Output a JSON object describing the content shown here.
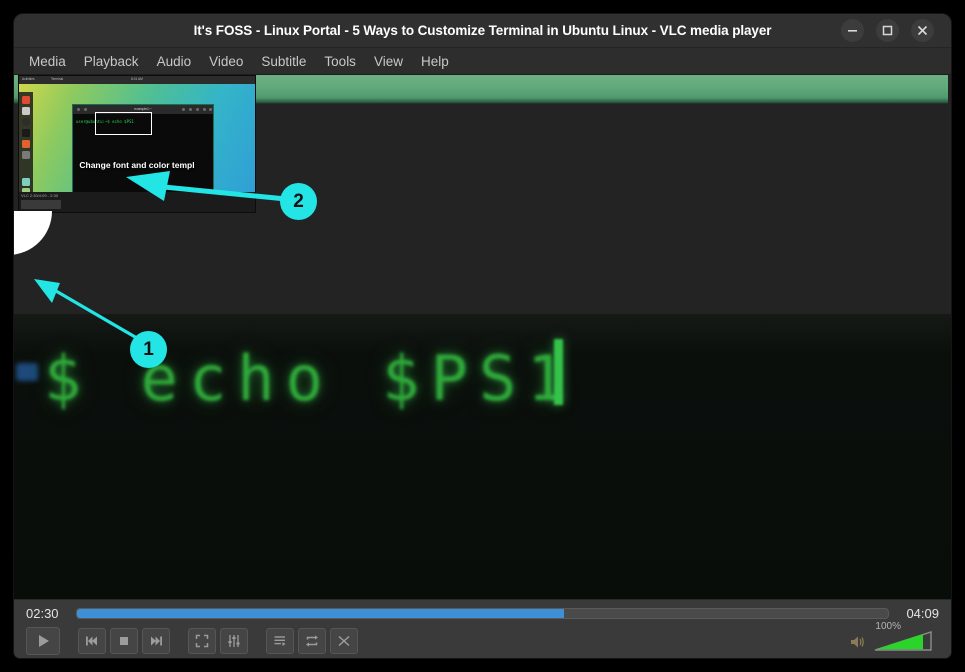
{
  "window": {
    "title": "It's FOSS - Linux Portal - 5 Ways to Customize Terminal in Ubuntu Linux - VLC media player",
    "controls": {
      "minimize": "minimize-button",
      "maximize": "maximize-button",
      "close": "close-button"
    }
  },
  "menubar": {
    "items": [
      {
        "label": "Media"
      },
      {
        "label": "Playback"
      },
      {
        "label": "Audio"
      },
      {
        "label": "Video"
      },
      {
        "label": "Subtitle"
      },
      {
        "label": "Tools"
      },
      {
        "label": "View"
      },
      {
        "label": "Help"
      }
    ]
  },
  "video": {
    "terminal_text": "$ echo $PS1",
    "background_color": "#0b0f0c",
    "upper_background_color": "#232323",
    "accent_green": "#2faa3a",
    "top_strip_color": "#61a87b"
  },
  "thumbnail": {
    "topbar_left": "Activities",
    "topbar_app": "Terminal",
    "topbar_clock": "8:31 AM",
    "terminal_title": "example1:~",
    "terminal_prompt": "user@ubuntu:~$ echo $PS1",
    "subtitle": "Change font and color templ",
    "bottom_label": "VLC 2:30/4:09 - 2:30"
  },
  "annotations": [
    {
      "number": "1",
      "color": "#23e5e5"
    },
    {
      "number": "2",
      "color": "#23e5e5"
    }
  ],
  "controls": {
    "elapsed": "02:30",
    "total": "04:09",
    "progress_percent": 60,
    "volume_percent": "100%",
    "volume_level": 100,
    "buttons": [
      {
        "name": "play",
        "label": "Play"
      },
      {
        "name": "previous",
        "label": "Previous"
      },
      {
        "name": "stop",
        "label": "Stop"
      },
      {
        "name": "next",
        "label": "Next"
      },
      {
        "name": "fullscreen",
        "label": "Toggle fullscreen"
      },
      {
        "name": "equalizer",
        "label": "Show extended settings"
      },
      {
        "name": "playlist",
        "label": "Show playlist"
      },
      {
        "name": "loop",
        "label": "Loop"
      },
      {
        "name": "shuffle",
        "label": "Random"
      }
    ],
    "seek_fill_color": "#3d8fd6",
    "volume_fill_color": "#2ad42a"
  }
}
